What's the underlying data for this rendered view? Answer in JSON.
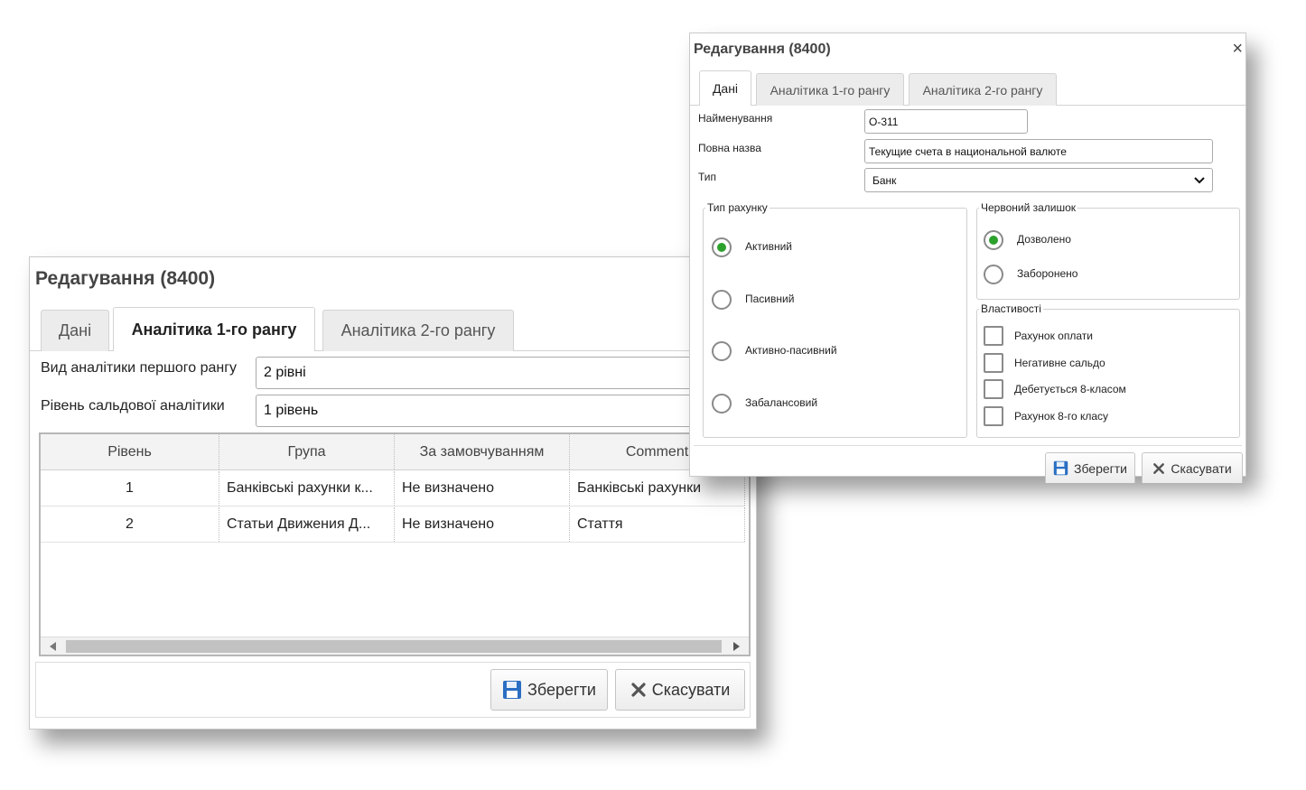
{
  "back_dialog": {
    "title": "Редагування (8400)",
    "tabs": [
      {
        "label": "Дані",
        "active": false
      },
      {
        "label": "Аналітика 1-го рангу",
        "active": true
      },
      {
        "label": "Аналітика 2-го рангу",
        "active": false
      }
    ],
    "fields": {
      "first_rank_label": "Вид аналітики першого рангу",
      "first_rank_value": "2 рівні",
      "balance_level_label": "Рівень сальдової аналітики",
      "balance_level_value": "1 рівень"
    },
    "grid": {
      "columns": [
        "Рівень",
        "Група",
        "За замовчуванням",
        "Comment"
      ],
      "rows": [
        {
          "level": "1",
          "group": "Банківські рахунки к...",
          "default": "Не визначено",
          "comment": "Банківські рахунки"
        },
        {
          "level": "2",
          "group": "Статьи Движения Д...",
          "default": "Не визначено",
          "comment": "Стаття"
        }
      ]
    },
    "buttons": {
      "save": "Зберегти",
      "cancel": "Скасувати"
    }
  },
  "front_dialog": {
    "title": "Редагування (8400)",
    "close_glyph": "×",
    "tabs": [
      {
        "label": "Дані",
        "active": true
      },
      {
        "label": "Аналітика 1-го рангу",
        "active": false
      },
      {
        "label": "Аналітика 2-го рангу",
        "active": false
      }
    ],
    "fields": {
      "name_label": "Найменування",
      "name_value": "О-311",
      "full_name_label": "Повна назва",
      "full_name_value": "Текущие счета в национальной валюте",
      "type_label": "Тип",
      "type_value": "Банк"
    },
    "account_type": {
      "legend": "Тип рахунку",
      "options": [
        "Активний",
        "Пасивний",
        "Активно-пасивний",
        "Забалансовий"
      ],
      "selected": "Активний"
    },
    "red_balance": {
      "legend": "Червоний залишок",
      "options": [
        "Дозволено",
        "Заборонено"
      ],
      "selected": "Дозволено"
    },
    "properties": {
      "legend": "Властивості",
      "options": [
        "Рахунок оплати",
        "Негативне сальдо",
        "Дебетується 8-класом",
        "Рахунок 8-го класу"
      ]
    },
    "buttons": {
      "save": "Зберегти",
      "cancel": "Скасувати"
    }
  },
  "colors": {
    "radio_checked": "#2ca12c",
    "save_icon": "#2a6fc2"
  }
}
